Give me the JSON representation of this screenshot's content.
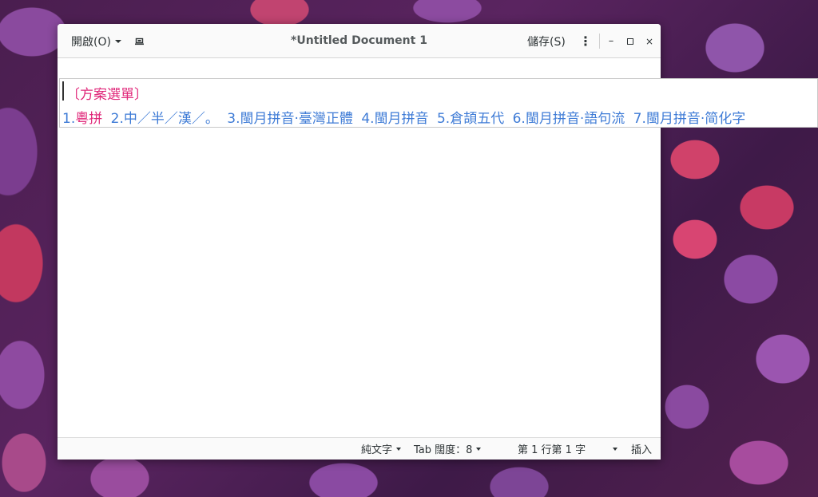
{
  "window": {
    "title": "*Untitled Document 1",
    "open_label": "開啟(O)",
    "save_label": "儲存(S)",
    "minimize_glyph": "–",
    "close_glyph": "×",
    "menu_glyph": "⋮"
  },
  "statusbar": {
    "language": "純文字",
    "tab_width": "Tab 闊度：8",
    "position": "第 1 行第 1 字",
    "insert_mode": "插入"
  },
  "ime": {
    "title": "〔方案選單〕",
    "candidates": [
      {
        "num": "1.",
        "text": "粵拼"
      },
      {
        "num": "2.",
        "text": "中／半／漢／。"
      },
      {
        "num": "3.",
        "text": "閩月拼音·臺灣正體"
      },
      {
        "num": "4.",
        "text": "閩月拼音"
      },
      {
        "num": "5.",
        "text": "倉頡五代"
      },
      {
        "num": "6.",
        "text": "閩月拼音·語句流"
      },
      {
        "num": "7.",
        "text": "閩月拼音·简化字"
      }
    ]
  },
  "colors": {
    "ime_highlight": "#e0287a",
    "ime_candidate": "#3e7bd6"
  },
  "icons": {
    "new_tab": "new-tab-icon",
    "menu": "kebab-menu-icon"
  }
}
